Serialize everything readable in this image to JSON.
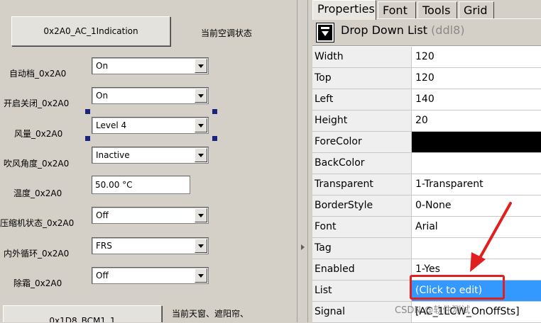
{
  "canvas": {
    "top_button": "0x2A0_AC_1Indication",
    "top_caption": "当前空调状态",
    "fields": [
      {
        "label": "自动档_0x2A0",
        "value": "On"
      },
      {
        "label": "开启关闭_0x2A0",
        "value": "On"
      },
      {
        "label": "风量_0x2A0",
        "value": "Level 4"
      },
      {
        "label": "吹风角度_0x2A0",
        "value": "Inactive"
      },
      {
        "label": "温度_0x2A0",
        "value": "50.00 °C"
      },
      {
        "label": "压缩机状态_0x2A0",
        "value": "Off"
      },
      {
        "label": "内外循环_0x2A0",
        "value": "FRS"
      },
      {
        "label": "除霜_0x2A0",
        "value": "Off"
      }
    ],
    "bottom_button": "0x1D8_BCM1_1",
    "bottom_caption": "当前天窗、遮阳帘、"
  },
  "inspector": {
    "tabs": [
      "Properties",
      "Font",
      "Tools",
      "Grid"
    ],
    "active_tab": "Properties",
    "control_type": "Drop Down List",
    "control_name": "(ddl8)",
    "properties": [
      {
        "name": "Width",
        "value": "120"
      },
      {
        "name": "Top",
        "value": "120"
      },
      {
        "name": "Left",
        "value": "140"
      },
      {
        "name": "Height",
        "value": "20"
      },
      {
        "name": "ForeColor",
        "value": ""
      },
      {
        "name": "BackColor",
        "value": ""
      },
      {
        "name": "Transparent",
        "value": "1-Transparent"
      },
      {
        "name": "BorderStyle",
        "value": "0-None"
      },
      {
        "name": "Font",
        "value": "Arial"
      },
      {
        "name": "Tag",
        "value": ""
      },
      {
        "name": "Enabled",
        "value": "1-Yes"
      },
      {
        "name": "List",
        "value": "(Click to edit)"
      },
      {
        "name": "Signal",
        "value": "[AC_1LCW_OnOffSts]"
      }
    ],
    "selected_property": "List"
  },
  "watermark": "CSDN @软件测试",
  "colors": {
    "selection": "#3399ff",
    "annotation": "#e02020",
    "forecolor_swatch": "#000000"
  }
}
